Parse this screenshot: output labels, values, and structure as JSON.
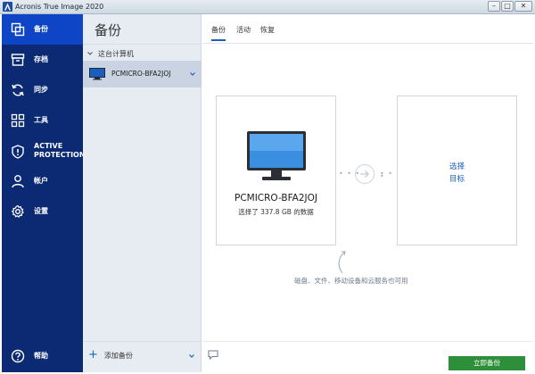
{
  "window": {
    "title": "Acronis True Image 2020",
    "minimize_label": "–",
    "maximize_label": "□",
    "close_label": "✕"
  },
  "nav": {
    "items": [
      {
        "label": "备份",
        "icon": "copy-icon",
        "active": true
      },
      {
        "label": "存档",
        "icon": "archive-icon",
        "active": false
      },
      {
        "label": "同步",
        "icon": "sync-icon",
        "active": false
      },
      {
        "label": "工具",
        "icon": "grid-icon",
        "active": false
      },
      {
        "label": "ACTIVE",
        "label2": "PROTECTION",
        "icon": "shield-icon",
        "active": false
      },
      {
        "label": "帐户",
        "icon": "user-icon",
        "active": false
      },
      {
        "label": "设置",
        "icon": "gear-icon",
        "active": false
      }
    ],
    "help_label": "帮助"
  },
  "backup_panel": {
    "title": "备份",
    "section_label": "这台计算机",
    "machine_name": "PCMICRO-BFA2JOJ",
    "add_backup_label": "添加备份"
  },
  "main": {
    "tabs": [
      {
        "label": "备份",
        "active": true
      },
      {
        "label": "活动",
        "active": false
      },
      {
        "label": "恢复",
        "active": false
      }
    ],
    "source": {
      "name": "PCMICRO-BFA2JOJ",
      "info": "选择了 337.8 GB 的数据"
    },
    "destination": {
      "line1": "选择",
      "line2": "目标"
    },
    "hint": "磁盘、文件、移动设备和云服务也可用",
    "start_button_label": "立即备份"
  },
  "colors": {
    "nav_bg": "#0b2a73",
    "nav_active": "#0d45c6",
    "accent": "#1a5fbf",
    "start_button": "#2d8f3a"
  }
}
